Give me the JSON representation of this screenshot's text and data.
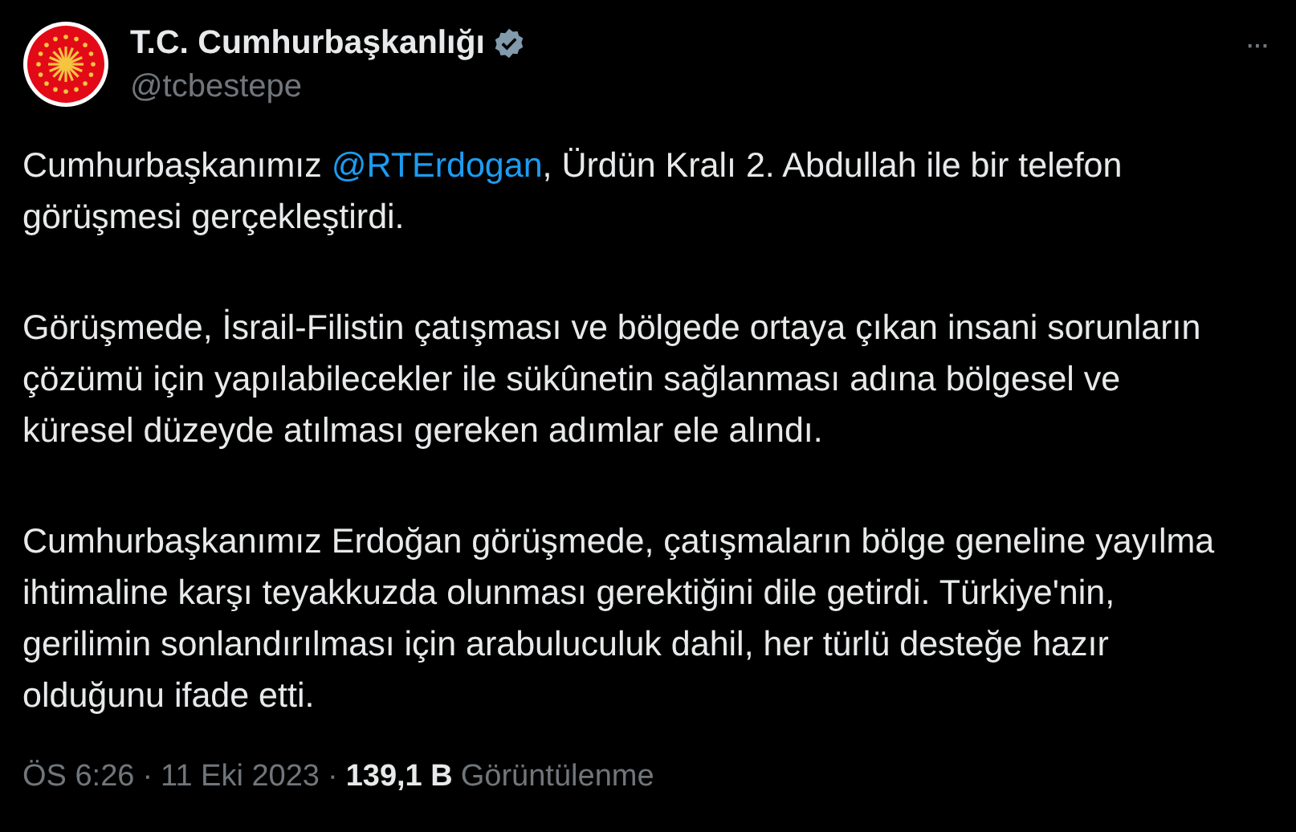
{
  "author": {
    "name": "T.C. Cumhurbaşkanlığı",
    "verified": true,
    "handle": "@tcbestepe"
  },
  "more_button": "···",
  "paragraphs": [
    {
      "before": "Cumhurbaşkanımız ",
      "mention": "@RTErdogan",
      "after": ", Ürdün Kralı 2. Abdullah ile bir telefon görüşmesi gerçekleştirdi."
    },
    {
      "before": "Görüşmede, İsrail-Filistin çatışması ve bölgede ortaya çıkan insani sorunların çözümü için yapılabilecekler ile sükûnetin sağlanması adına bölgesel ve küresel düzeyde atılması gereken adımlar ele alındı."
    },
    {
      "before": "Cumhurbaşkanımız Erdoğan görüşmede, çatışmaların bölge geneline yayılma ihtimaline karşı teyakkuzda olunması gerektiğini dile getirdi. Türkiye'nin, gerilimin sonlandırılması için arabuluculuk dahil, her türlü desteğe hazır olduğunu ifade etti."
    }
  ],
  "footer": {
    "time": "ÖS 6:26",
    "separator": "·",
    "date": "11 Eki 2023",
    "separator_2": "·",
    "views_count": "139,1 B",
    "views_label": "Görüntülenme"
  }
}
